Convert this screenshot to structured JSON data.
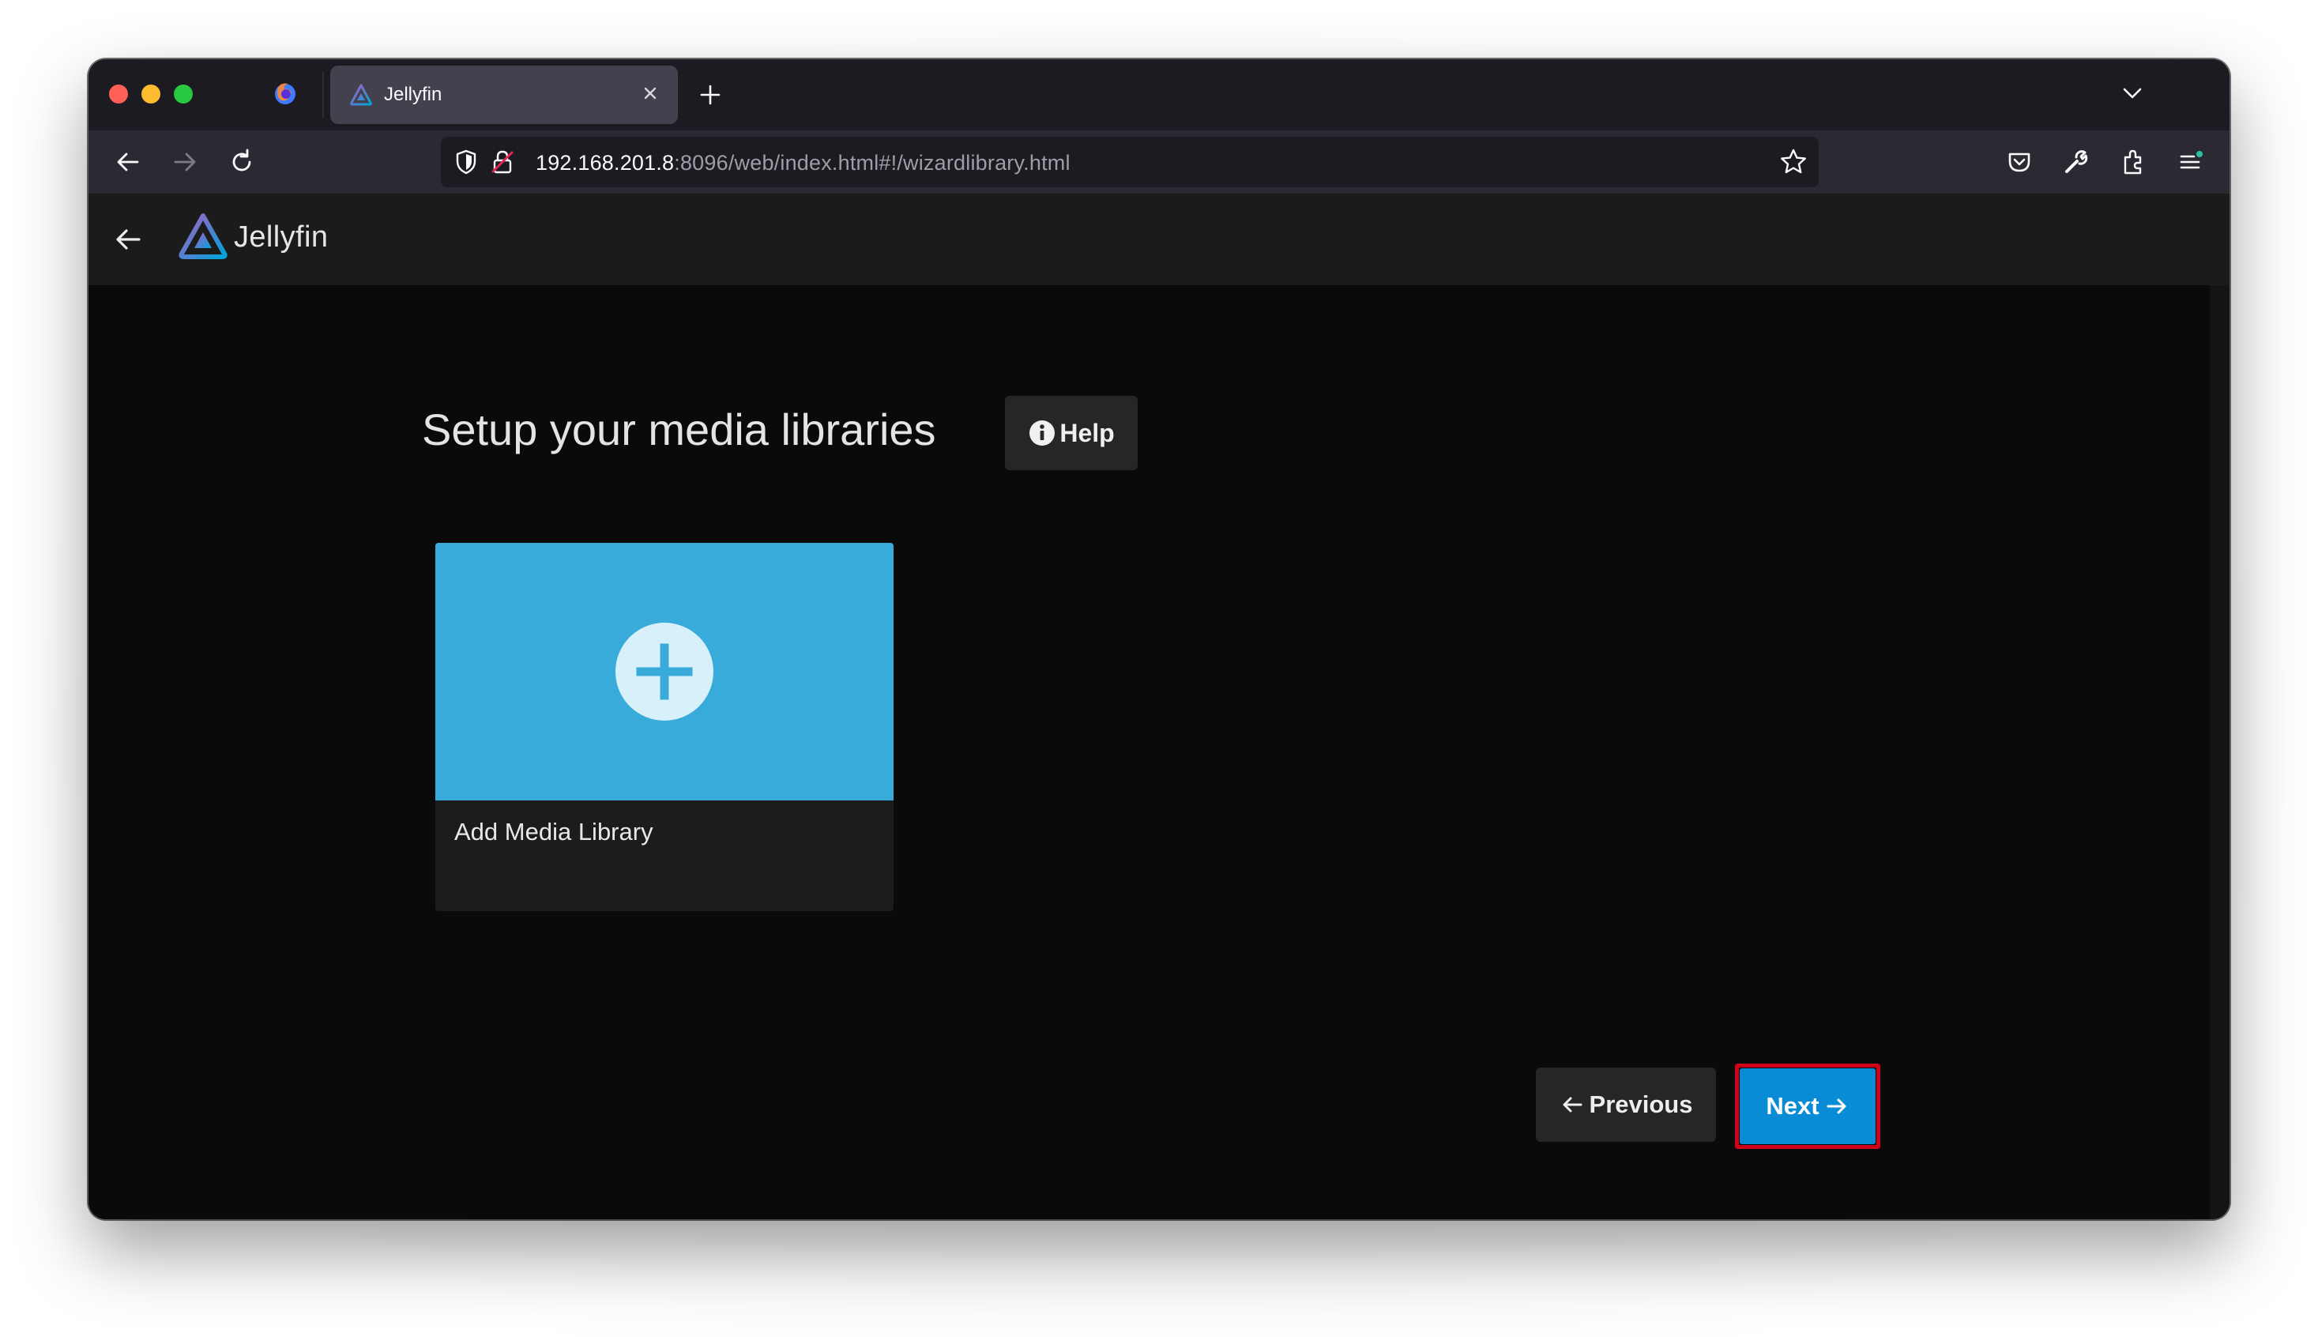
{
  "browser": {
    "tab": {
      "title": "Jellyfin"
    },
    "url": {
      "host": "192.168.201.8",
      "path": ":8096/web/index.html#!/wizardlibrary.html"
    }
  },
  "app": {
    "name": "Jellyfin",
    "accent_color": "#0a8bd6",
    "card_color": "#38abdb"
  },
  "wizard": {
    "title": "Setup your media libraries",
    "help_label": "Help",
    "add_library_label": "Add Media Library",
    "previous_label": "Previous",
    "next_label": "Next"
  }
}
